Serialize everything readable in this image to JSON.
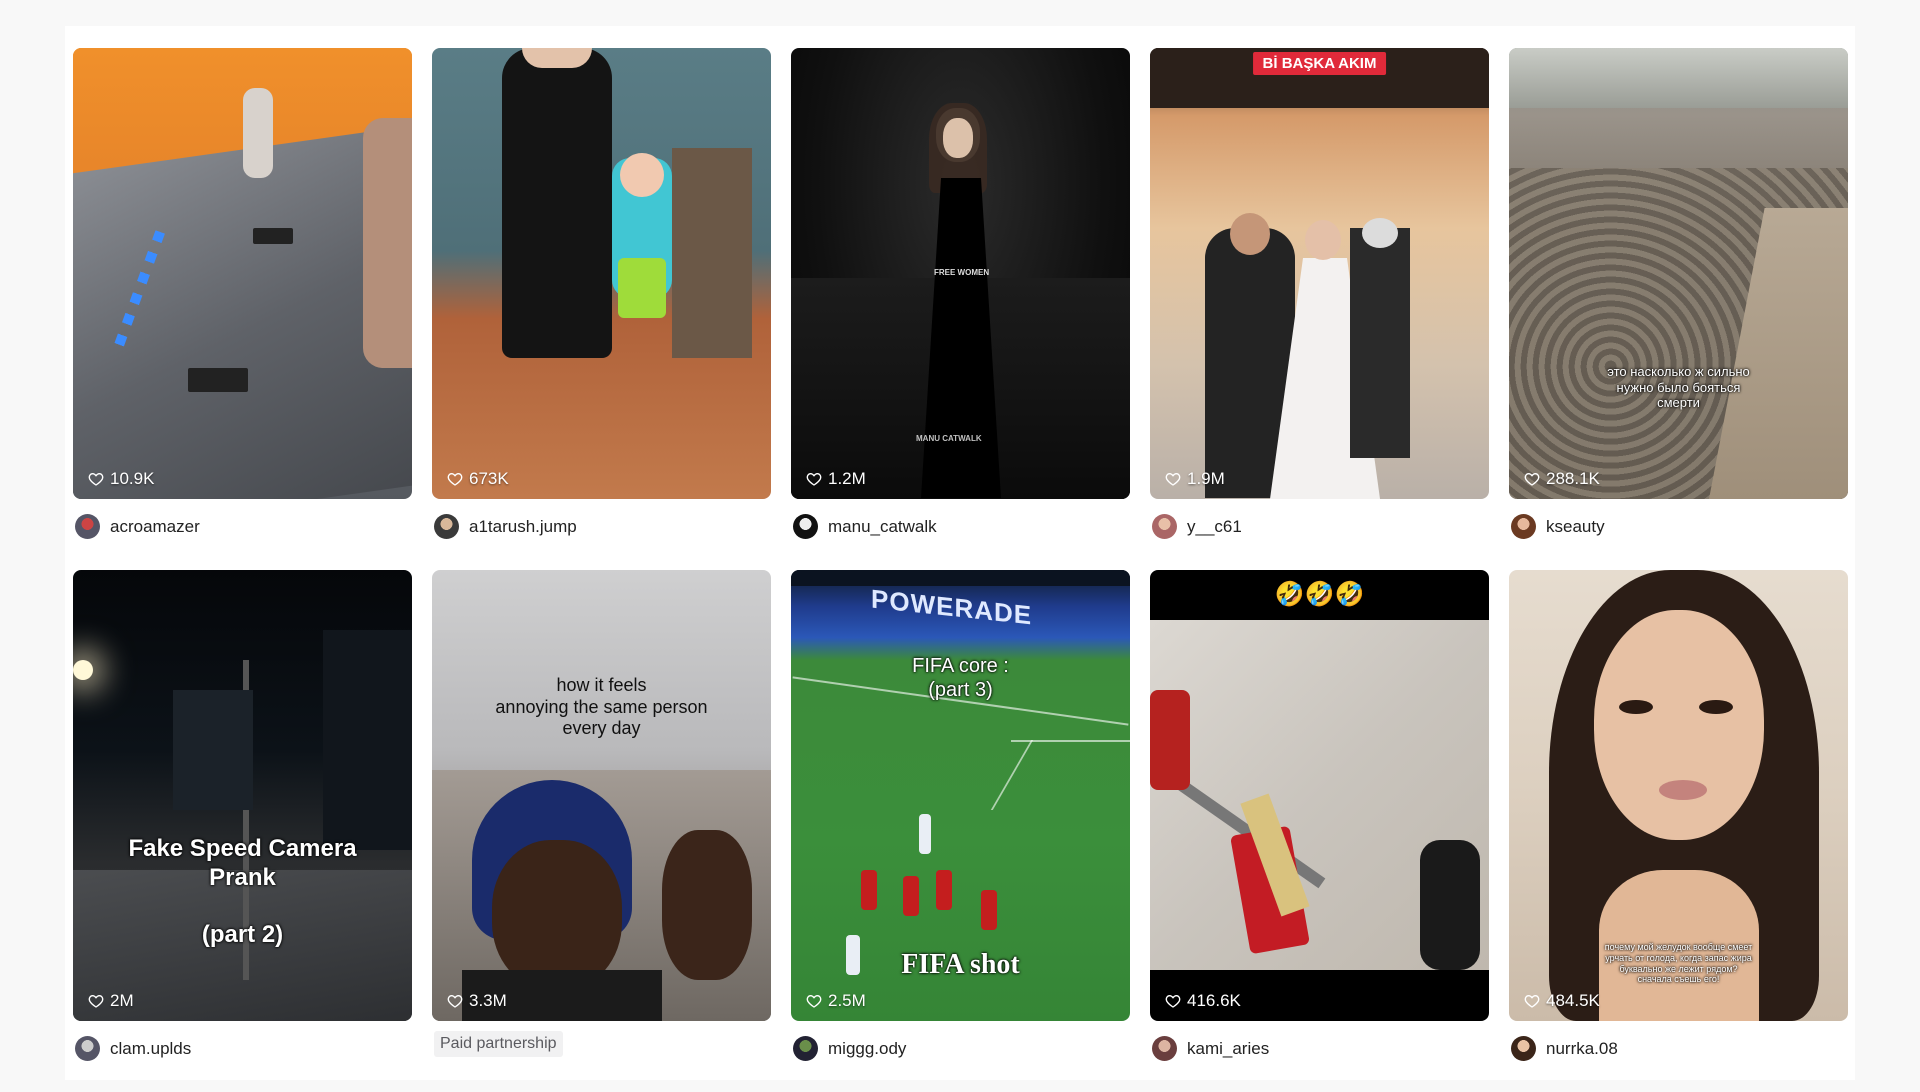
{
  "videos": [
    {
      "likes": "10.9K",
      "author": "acroamazer"
    },
    {
      "likes": "673K",
      "author": "a1tarush.jump"
    },
    {
      "likes": "1.2M",
      "author": "manu_catwalk",
      "watermark": "MANU CATWALK",
      "shirt_text": "FREE WOMEN"
    },
    {
      "likes": "1.9M",
      "author": "y__c61",
      "banner": "Bİ BAŞKA AKIM"
    },
    {
      "likes": "288.1K",
      "author": "kseauty",
      "caption_lines": [
        "это насколько ж сильно",
        "нужно было бояться",
        "смерти"
      ]
    },
    {
      "likes": "2M",
      "author": "clam.uplds",
      "caption_lines": [
        "Fake Speed Camera",
        "Prank",
        "",
        "(part 2)"
      ]
    },
    {
      "likes": "3.3M",
      "badge": "Paid partnership",
      "caption_lines": [
        "how it feels",
        "annoying the same person",
        "every day"
      ]
    },
    {
      "likes": "2.5M",
      "author": "miggg.ody",
      "caption_lines": [
        "FIFA core :",
        "(part 3)"
      ],
      "caption2": "FIFA shot",
      "ad_text": "POWERADE"
    },
    {
      "likes": "416.6K",
      "author": "kami_aries",
      "emojis": "🤣🤣🤣"
    },
    {
      "likes": "484.5K",
      "author": "nurrka.08",
      "caption_lines": [
        "почему мой желудок вообще смеет",
        "урчать от голода, когда запас жира",
        "буквально же лежит рядом?",
        "сначала съешь его!"
      ]
    }
  ],
  "colors": {
    "banner": "#e02a3a",
    "text": "#222222",
    "muted": "#5a5a5f"
  },
  "icons": {
    "likes": "heart-outline-icon"
  }
}
